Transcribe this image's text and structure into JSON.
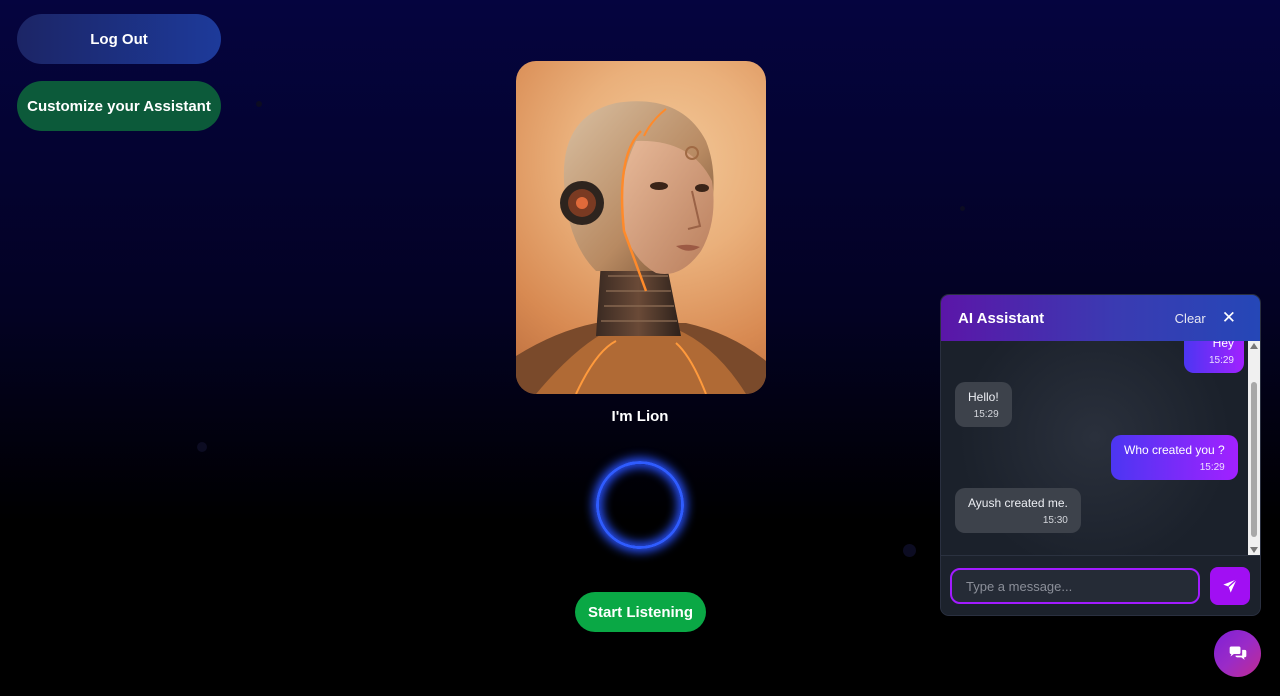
{
  "nav": {
    "logout_label": "Log Out",
    "customize_label": "Customize your Assistant"
  },
  "assistant": {
    "name_label": "I'm Lion",
    "start_label": "Start Listening"
  },
  "chat": {
    "title": "AI Assistant",
    "clear_label": "Clear",
    "close_icon": "close-icon",
    "messages": [
      {
        "sender": "user",
        "text": "Hey",
        "time": "15:29"
      },
      {
        "sender": "assistant",
        "text": "Hello!",
        "time": "15:29"
      },
      {
        "sender": "user",
        "text": "Who created you ?",
        "time": "15:29"
      },
      {
        "sender": "assistant",
        "text": "Ayush created me.",
        "time": "15:30"
      }
    ],
    "input_placeholder": "Type a message...",
    "send_icon": "send-icon",
    "toggle_icon": "chat-bubbles-icon"
  },
  "colors": {
    "accent_purple": "#a10ff3",
    "listen_green": "#0aa845",
    "customize_green": "#0c5a3a",
    "ring_blue": "#2f5cff"
  }
}
